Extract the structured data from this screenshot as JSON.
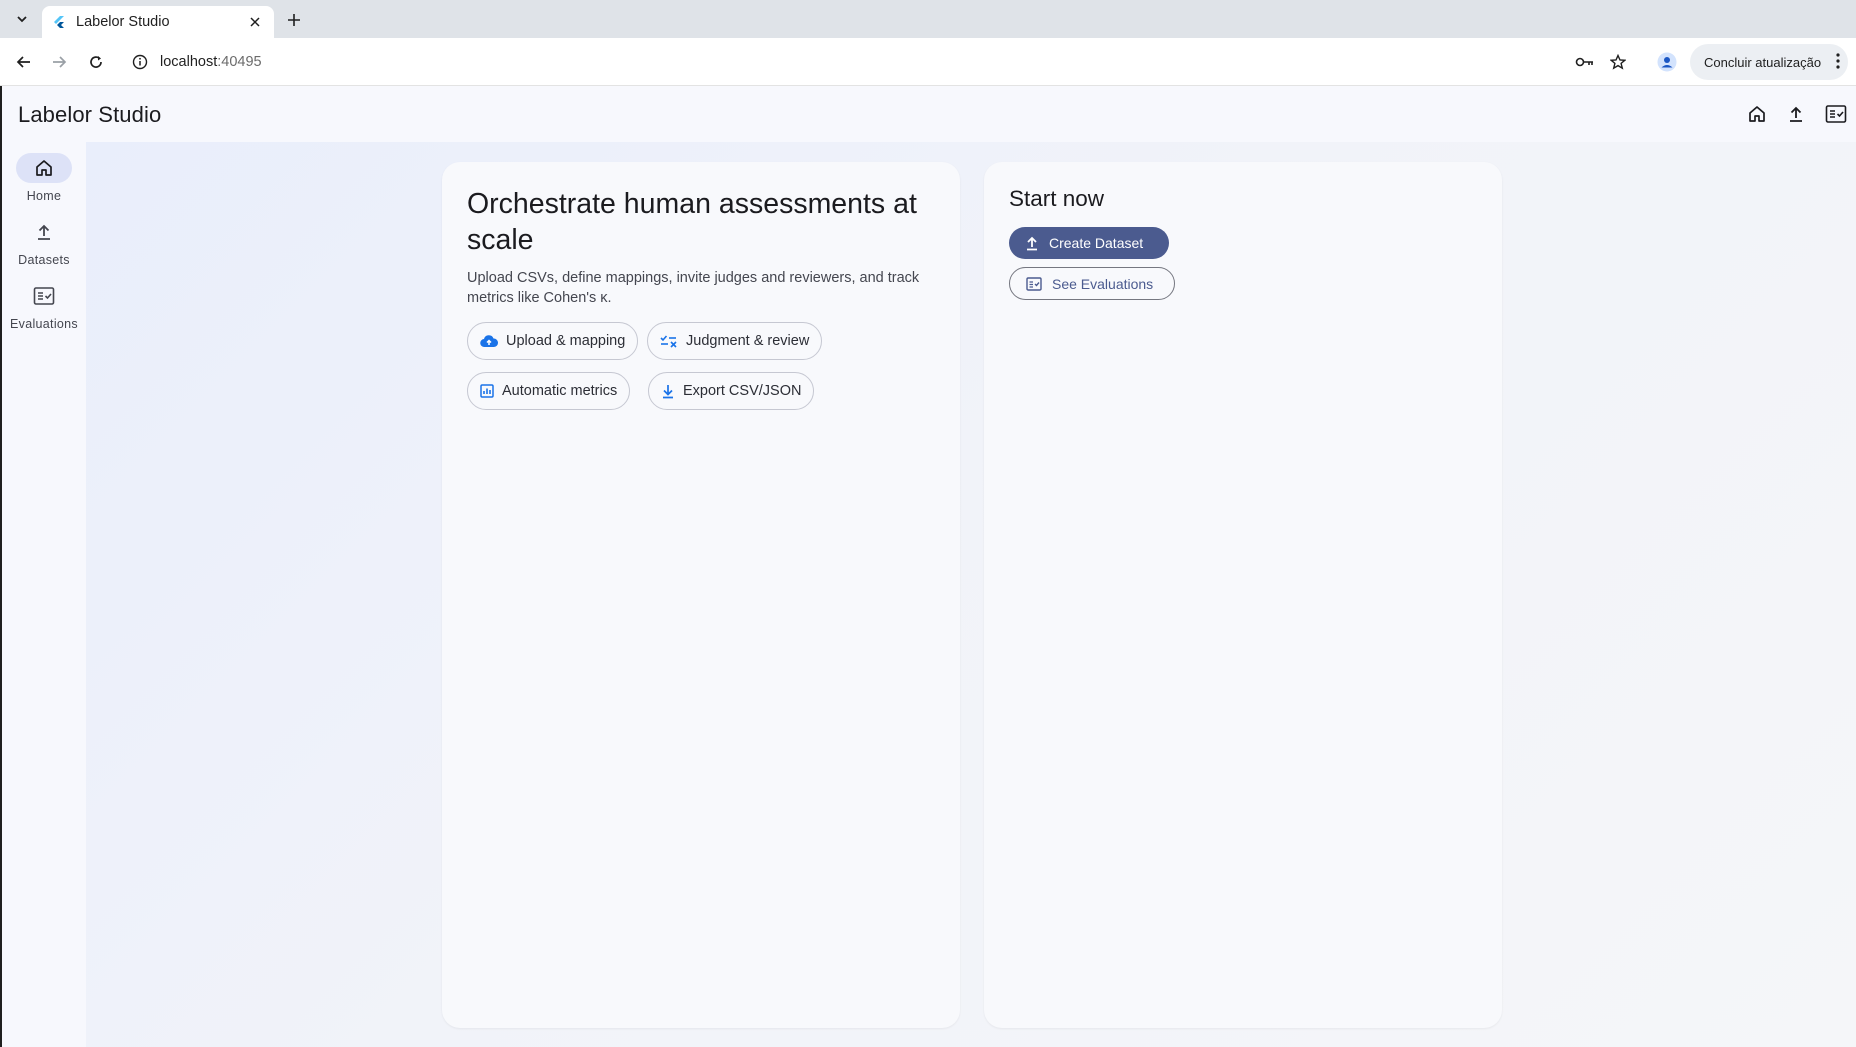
{
  "browser": {
    "tab_title": "Labelor Studio",
    "url_host": "localhost",
    "url_port": ":40495",
    "update_label": "Concluir atualização"
  },
  "app": {
    "title": "Labelor Studio",
    "nav": [
      {
        "label": "Home",
        "icon": "home-icon",
        "active": true
      },
      {
        "label": "Datasets",
        "icon": "upload-icon",
        "active": false
      },
      {
        "label": "Evaluations",
        "icon": "fact-check-icon",
        "active": false
      }
    ],
    "appbar_actions": [
      "home-icon",
      "upload-icon",
      "fact-check-icon"
    ]
  },
  "hero": {
    "title": "Orchestrate human assessments at scale",
    "subtitle": "Upload CSVs, define mappings, invite judges and reviewers, and track metrics like Cohen's κ.",
    "chips": [
      {
        "label": "Upload & mapping",
        "icon": "cloud-upload-icon"
      },
      {
        "label": "Judgment & review",
        "icon": "rule-icon"
      },
      {
        "label": "Automatic metrics",
        "icon": "analytics-icon"
      },
      {
        "label": "Export CSV/JSON",
        "icon": "download-icon"
      }
    ]
  },
  "start": {
    "title": "Start now",
    "create_label": "Create Dataset",
    "evaluations_label": "See Evaluations"
  },
  "colors": {
    "primary": "#4b5b8f",
    "accent_blue": "#1a73e8",
    "rail_active": "#dde2f7"
  }
}
